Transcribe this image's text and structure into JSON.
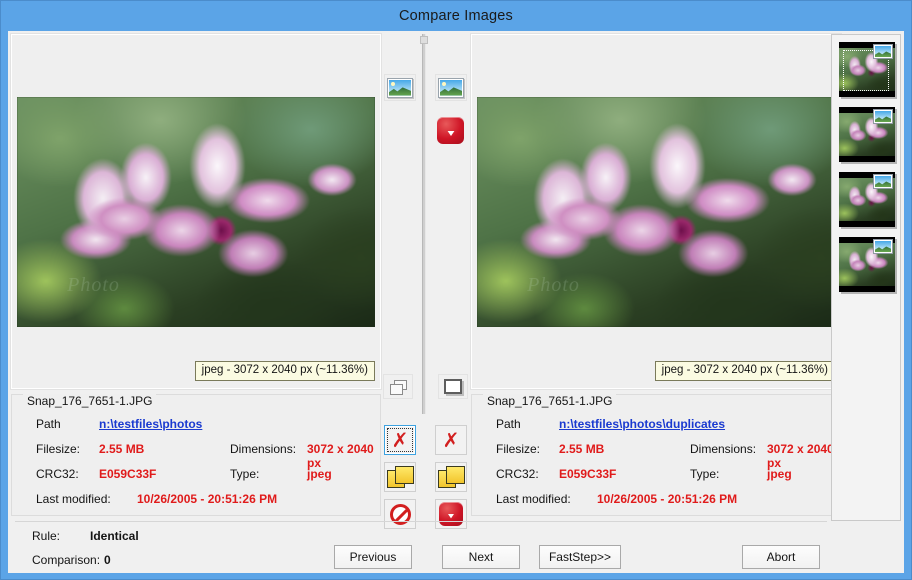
{
  "window": {
    "title": "Compare Images",
    "frame_color": "#5ba4e7",
    "client_bg": "#f0f0f0"
  },
  "colors": {
    "accent_blue": "#5ba4e7",
    "value_red": "#e01b1b",
    "link_blue": "#1a3ad0",
    "tooltip_bg": "#fbfbe2",
    "icon_red": "#cf1526",
    "icon_yellow": "#ffe96a"
  },
  "left_panel": {
    "size_tag": "jpeg - 3072 x 2040 px (~11.36%)",
    "photo_watermark": "Photo",
    "info": {
      "filename": "Snap_176_7651-1.JPG",
      "path_label": "Path",
      "path_value": "n:\\testfiles\\photos",
      "filesize_label": "Filesize:",
      "filesize_value": "2.55 MB",
      "dimensions_label": "Dimensions:",
      "dimensions_value": "3072 x 2040 px",
      "crc32_label": "CRC32:",
      "crc32_value": "E059C33F",
      "type_label": "Type:",
      "type_value": "jpeg",
      "modified_label": "Last modified:",
      "modified_value": "10/26/2005 - 20:51:26 PM"
    },
    "toolbar": {
      "preview_icon": "picture-icon",
      "restore_icon": "window-restore-icon"
    },
    "actions": [
      {
        "name": "delete-left-button",
        "icon": "red-x-icon",
        "focused": true
      },
      {
        "name": "copy-left-button",
        "icon": "copy-notes-icon",
        "focused": false
      },
      {
        "name": "skip-left-button",
        "icon": "no-entry-icon",
        "focused": false
      }
    ]
  },
  "right_panel": {
    "size_tag": "jpeg - 3072 x 2040 px (~11.36%)",
    "photo_watermark": "Photo",
    "info": {
      "filename": "Snap_176_7651-1.JPG",
      "path_label": "Path",
      "path_value": "n:\\testfiles\\photos\\duplicates",
      "filesize_label": "Filesize:",
      "filesize_value": "2.55 MB",
      "dimensions_label": "Dimensions:",
      "dimensions_value": "3072 x 2040 px",
      "crc32_label": "CRC32:",
      "crc32_value": "E059C33F",
      "type_label": "Type:",
      "type_value": "jpeg",
      "modified_label": "Last modified:",
      "modified_value": "10/26/2005 - 20:51:26 PM"
    },
    "toolbar": {
      "preview_icon": "picture-icon",
      "download_icon": "red-down-arrow-icon",
      "maximize_icon": "window-maximize-icon"
    },
    "actions": [
      {
        "name": "delete-right-button",
        "icon": "red-x-icon",
        "focused": false
      },
      {
        "name": "copy-right-button",
        "icon": "copy-notes-icon",
        "focused": false
      },
      {
        "name": "move-right-button",
        "icon": "red-down-arrow-icon",
        "focused": false
      }
    ]
  },
  "thumbnails": {
    "count": 4,
    "items": [
      {
        "name": "thumbnail-1",
        "selected": true,
        "badge_icon": "picture-icon"
      },
      {
        "name": "thumbnail-2",
        "selected": false,
        "badge_icon": "picture-icon"
      },
      {
        "name": "thumbnail-3",
        "selected": false,
        "badge_icon": "picture-icon"
      },
      {
        "name": "thumbnail-4",
        "selected": false,
        "badge_icon": "picture-icon"
      }
    ]
  },
  "status": {
    "rule_label": "Rule:",
    "rule_value": "Identical",
    "comparison_label": "Comparison:",
    "comparison_value": "0"
  },
  "buttons": {
    "previous": "Previous",
    "next": "Next",
    "faststep": "FastStep>>",
    "abort": "Abort"
  }
}
